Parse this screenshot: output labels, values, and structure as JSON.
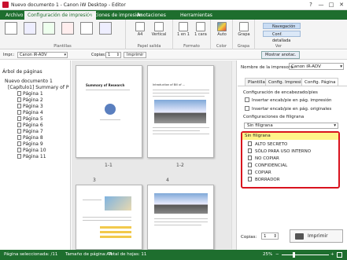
{
  "window": {
    "title": "Nuevo documento 1 - Canon iW Desktop - Editor",
    "controls": [
      "?",
      "—",
      "□",
      "✕"
    ]
  },
  "ribbon_tabs": [
    "Archivo",
    "Configuración de impresión",
    "Opciones de impresión",
    "Anotaciones",
    "Herramientas"
  ],
  "ribbon": {
    "groups": [
      "Plantillas",
      "Papel salida",
      "Formato",
      "Color",
      "Grapa",
      "Ver"
    ],
    "paper_size": "A4",
    "orientation": "Vertical",
    "layout": "1 en 1",
    "duplex": "1 cara",
    "color": "Auto",
    "staple": "Grapa",
    "nav_button": "Navegación",
    "detail_button": "Conf. detallada"
  },
  "toolbar": {
    "printer_label": "Impr.:",
    "printer_value": "Canon iR-ADV",
    "copies_label": "Copias:",
    "copies_value": "1",
    "print_label": "Imprimir",
    "show_notes": "Mostrar anotac."
  },
  "tree": {
    "title": "Árbol de páginas",
    "root": "Nuevo documento 1",
    "child": "[Capítulo1] Summary of P",
    "pages": [
      "Página 1",
      "Página 2",
      "Página 3",
      "Página 4",
      "Página 5",
      "Página 6",
      "Página 7",
      "Página 8",
      "Página 9",
      "Página 10",
      "Página 11"
    ]
  },
  "pages": {
    "labels": [
      "1-1",
      "1-2",
      "3",
      "4"
    ],
    "page1_title": "Summary of Research",
    "page2_title": "Introduction of Bill of ..."
  },
  "rightpane": {
    "printer_label": "Nombre de la impresora:",
    "printer_value": "Canon iR-ADV",
    "tabs": [
      "Plantillas",
      "Config. Impresión",
      "Config. Página"
    ],
    "header_section": "Configuración de encabezado/pies",
    "opt1": "Insertar encab/pie en pág. impresión",
    "opt2": "Insertar encab/pie en pág. originales",
    "watermark_section": "Configuraciones de filigrana",
    "watermark_selected": "Sin filigrana",
    "watermark_options": [
      "Sin filigrana",
      "ALTO SECRETO",
      "SÓLO PARA USO INTERNO",
      "NO COPIAR",
      "CONFIDENCIAL",
      "COPIAR",
      "BORRADOR"
    ],
    "copies_label": "Copias:",
    "copies_value": "1",
    "print_label": "Imprimir"
  },
  "status": {
    "selected": "Página seleccionada: /11",
    "paper": "Tamaño de página:A4",
    "total": "Total de hojas: 11",
    "zoom": "25%"
  },
  "colors": {
    "accent": "#1e6e2e",
    "highlight": "#d9131e",
    "selection": "#fff38a"
  }
}
